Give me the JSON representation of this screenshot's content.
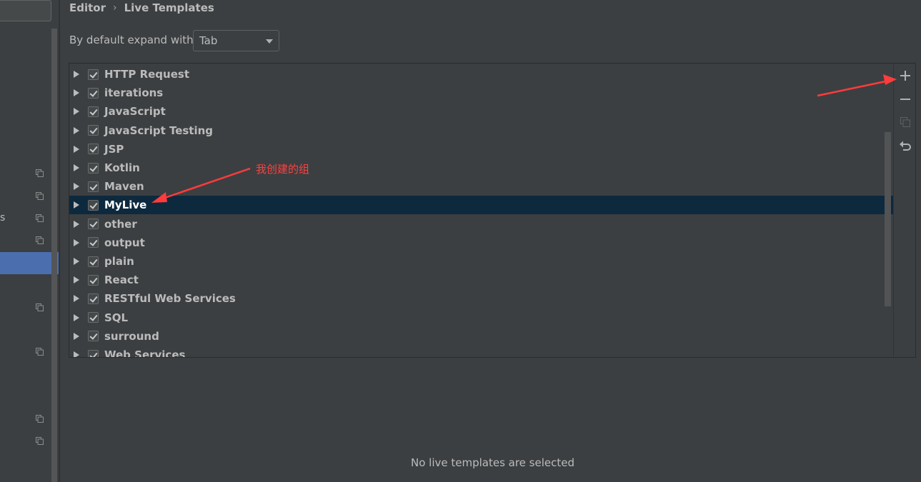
{
  "breadcrumb": {
    "parent": "Editor",
    "separator": "›",
    "current": "Live Templates"
  },
  "expand": {
    "label": "By default expand with",
    "selected": "Tab"
  },
  "sidebar": {
    "visible_fragment": "s"
  },
  "template_groups": [
    {
      "label": "HTTP Request",
      "checked": true
    },
    {
      "label": "iterations",
      "checked": true
    },
    {
      "label": "JavaScript",
      "checked": true
    },
    {
      "label": "JavaScript Testing",
      "checked": true
    },
    {
      "label": "JSP",
      "checked": true
    },
    {
      "label": "Kotlin",
      "checked": true
    },
    {
      "label": "Maven",
      "checked": true
    },
    {
      "label": "MyLive",
      "checked": true,
      "selected": true
    },
    {
      "label": "other",
      "checked": true
    },
    {
      "label": "output",
      "checked": true
    },
    {
      "label": "plain",
      "checked": true
    },
    {
      "label": "React",
      "checked": true
    },
    {
      "label": "RESTful Web Services",
      "checked": true
    },
    {
      "label": "SQL",
      "checked": true
    },
    {
      "label": "surround",
      "checked": true
    },
    {
      "label": "Web Services",
      "checked": true
    }
  ],
  "toolbar": {
    "add": "+",
    "remove": "−"
  },
  "annotation": {
    "text": "我创建的组"
  },
  "status": {
    "empty": "No live templates are selected"
  },
  "colors": {
    "selection": "#0d293e",
    "sidebar_selected": "#4b6eaf",
    "annotation": "#ff4040"
  }
}
